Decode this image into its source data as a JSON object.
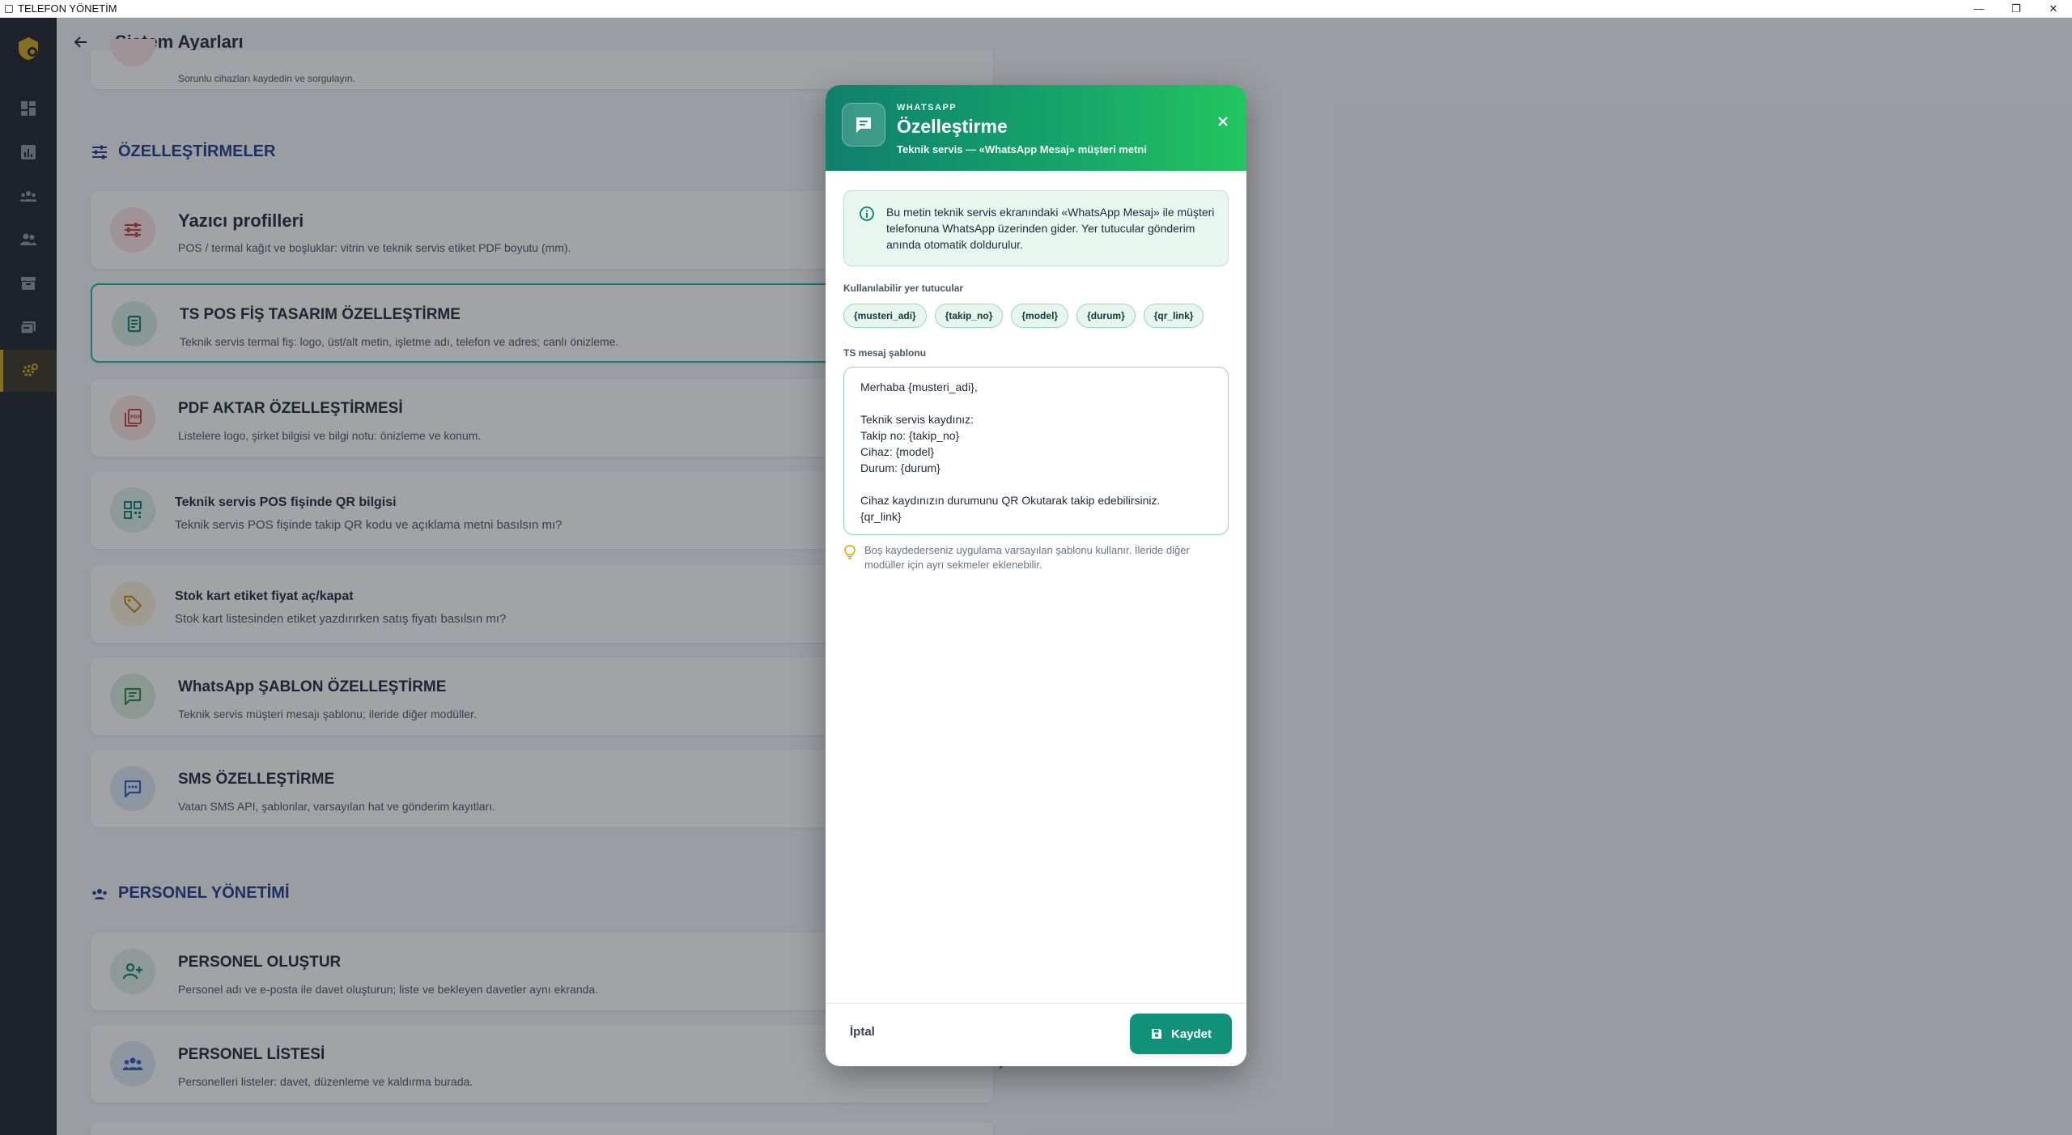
{
  "window": {
    "title": "TELEFON YÖNETİM",
    "minimize": "—",
    "restore": "❐",
    "close": "✕"
  },
  "header": {
    "title": "Sistem Ayarları"
  },
  "top_card": {
    "subtitle": "Sorunlu cihazları kaydedin ve sorgulayın."
  },
  "sections": {
    "customizations": "ÖZELLEŞTİRMELER",
    "personnel": "PERSONEL YÖNETİMİ"
  },
  "cards": [
    {
      "title": "Yazıcı profilleri",
      "subtitle": "POS / termal kağıt ve boşluklar: vitrin ve teknik servis etiket PDF boyutu (mm)."
    },
    {
      "title": "TS POS FİŞ TASARIM ÖZELLEŞTİRME",
      "subtitle": "Teknik servis termal fiş: logo, üst/alt metin, işletme adı, telefon ve adres; canlı önizleme."
    },
    {
      "title": "PDF AKTAR ÖZELLEŞTİRMESİ",
      "subtitle": "Listelere logo, şirket bilgisi ve bilgi notu: önizleme ve konum."
    },
    {
      "title": "Teknik servis POS fişinde QR bilgisi",
      "subtitle": "Teknik servis POS fişinde takip QR kodu ve açıklama metni basılsın mı?"
    },
    {
      "title": "Stok kart etiket fiyat aç/kapat",
      "subtitle": "Stok kart listesinden etiket yazdırırken satış fiyatı basılsın mı?"
    },
    {
      "title": "WhatsApp ŞABLON ÖZELLEŞTİRME",
      "subtitle": "Teknik servis müşteri mesajı şablonu; ileride diğer modüller."
    },
    {
      "title": "SMS ÖZELLEŞTİRME",
      "subtitle": "Vatan SMS API, şablonlar, varsayılan hat ve gönderim kayıtları."
    },
    {
      "title": "PERSONEL OLUŞTUR",
      "subtitle": "Personel adı ve e-posta ile davet oluşturun; liste ve bekleyen davetler aynı ekranda."
    },
    {
      "title": "PERSONEL LİSTESİ",
      "subtitle": "Personelleri listeler: davet, düzenleme ve kaldırma burada."
    }
  ],
  "dialog": {
    "kicker": "WHATSAPP",
    "title": "Özelleştirme",
    "subtitle": "Teknik servis — «WhatsApp Mesaj» müşteri metni",
    "info": "Bu metin teknik servis ekranındaki «WhatsApp Mesaj» ile müşteri telefonuna WhatsApp üzerinden gider. Yer tutucular gönderim anında otomatik doldurulur.",
    "placeholders_label": "Kullanılabilir yer tutucular",
    "placeholders": [
      "{musteri_adi}",
      "{takip_no}",
      "{model}",
      "{durum}",
      "{qr_link}"
    ],
    "template_label": "TS mesaj şablonu",
    "template_lines": [
      "Merhaba {musteri_adi},",
      "",
      "Teknik servis kaydınız:",
      "Takip no: {takip_no}",
      "Cihaz: {model}",
      "Durum: {durum}",
      "",
      "Cihaz kaydınızın durumunu QR Okutarak takip edebilirsiniz.",
      "{qr_link}"
    ],
    "hint": "Boş kaydederseniz uygulama varsayılan şablonu kullanır. İleride diğer modüller için ayrı sekmeler eklenebilir.",
    "cancel_label": "İptal",
    "save_label": "Kaydet"
  },
  "colors": {
    "accent": "#11917a",
    "sidebar": "#1c2129",
    "active_nav": "#d4a419"
  }
}
